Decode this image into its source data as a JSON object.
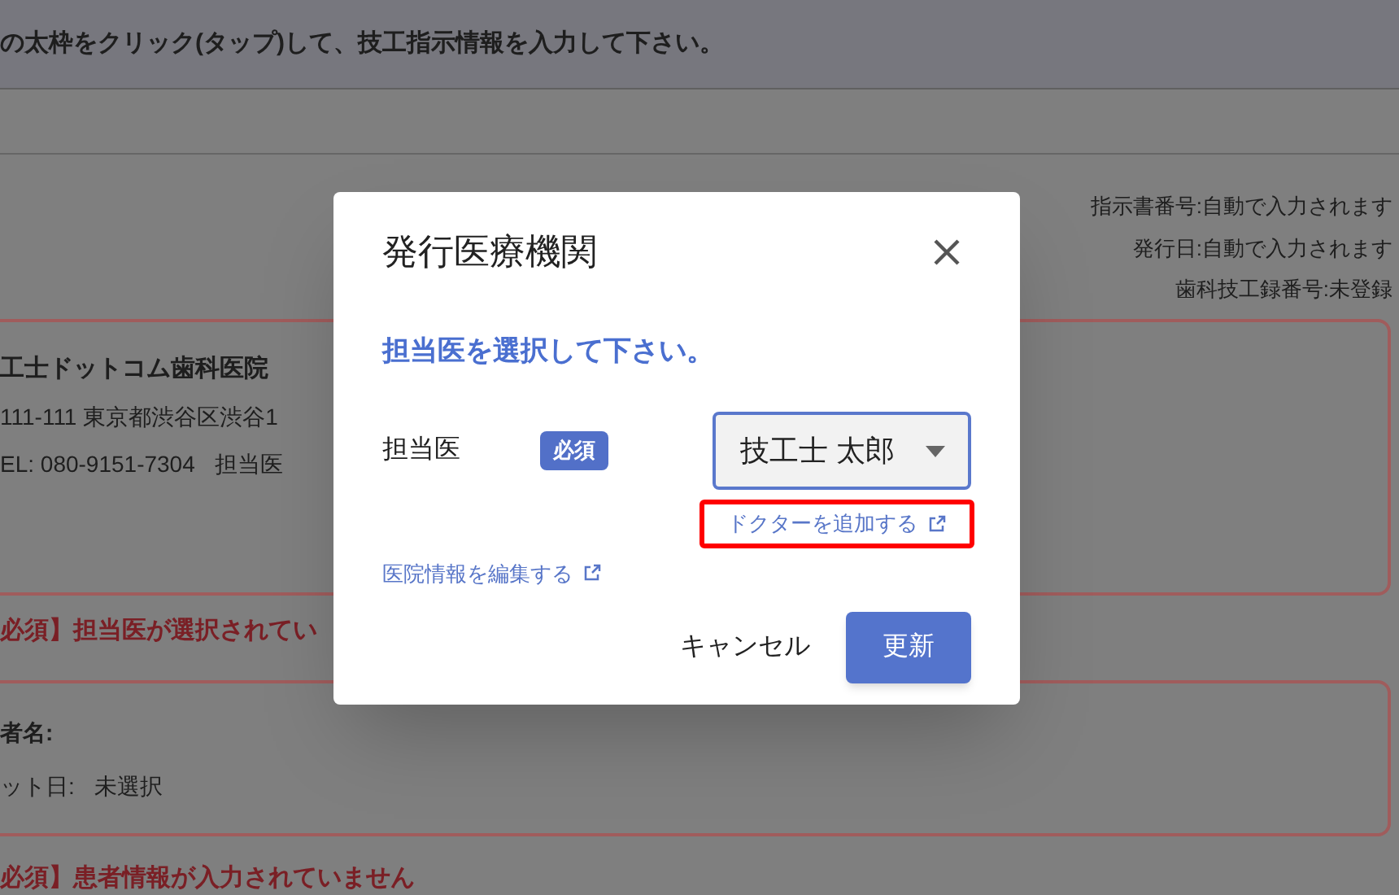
{
  "page": {
    "instruction": "の太枠をクリック(タップ)して、技工指示情報を入力して下さい。",
    "meta": [
      "指示書番号:自動で入力されます",
      "発行日:自動で入力されます",
      "歯科技工録番号:未登録"
    ],
    "clinic_card": {
      "name": "工士ドットコム歯科医院",
      "address": "111-111 東京都渋谷区渋谷1",
      "phone": "EL: 080-9151-7304",
      "doctor_label": "担当医"
    },
    "clinic_error": "必須】担当医が選択されてい",
    "patient_card": {
      "name_label": "者名:",
      "date_label": "ット日:",
      "date_value": "未選択"
    },
    "patient_error": "必須】患者情報が入力されていません"
  },
  "dialog": {
    "title": "発行医療機関",
    "prompt": "担当医を選択して下さい。",
    "field": {
      "label": "担当医",
      "badge": "必須",
      "value": "技工士 太郎"
    },
    "links": [
      {
        "label": "ドクターを追加する",
        "highlighted": true
      },
      {
        "label": "医院情報を編集する",
        "highlighted": false
      }
    ],
    "buttons": [
      {
        "label": "キャンセル",
        "kind": "text"
      },
      {
        "label": "更新",
        "kind": "primary"
      }
    ]
  }
}
